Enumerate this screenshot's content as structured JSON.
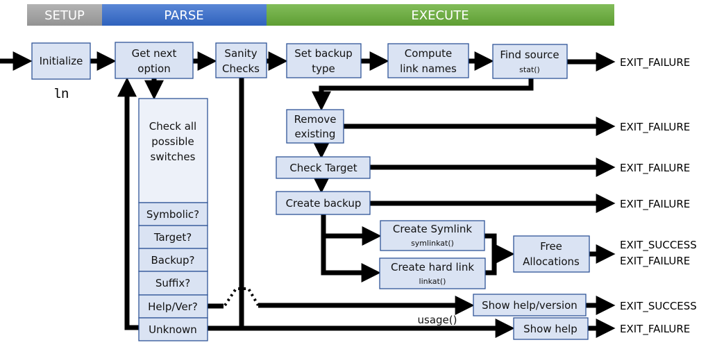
{
  "phases": [
    {
      "label": "SETUP",
      "color": "#a6a6a6"
    },
    {
      "label": "PARSE",
      "color": "#4472c4"
    },
    {
      "label": "EXECUTE",
      "color": "#70ad47"
    }
  ],
  "program_name": "ln",
  "nodes": {
    "initialize": "Initialize",
    "get_next_option": [
      "Get next",
      "option"
    ],
    "sanity_checks": [
      "Sanity",
      "Checks"
    ],
    "set_backup_type": [
      "Set backup",
      "type"
    ],
    "compute_link_names": [
      "Compute",
      "link names"
    ],
    "find_source": {
      "label": "Find source",
      "sub": "stat()"
    },
    "check_switches": [
      "Check all",
      "possible",
      "switches"
    ],
    "switches": [
      "Symbolic?",
      "Target?",
      "Backup?",
      "Suffix?",
      "Help/Ver?",
      "Unknown"
    ],
    "remove_existing": [
      "Remove",
      "existing"
    ],
    "check_target": "Check Target",
    "create_backup": "Create backup",
    "create_symlink": {
      "label": "Create Symlink",
      "sub": "symlinkat()"
    },
    "create_hard_link": {
      "label": "Create hard link",
      "sub": "linkat()"
    },
    "free_allocations": [
      "Free",
      "Allocations"
    ],
    "show_help_version": "Show help/version",
    "show_help": "Show help"
  },
  "edge_labels": {
    "usage": "usage()"
  },
  "exits": {
    "find_source": "EXIT_FAILURE",
    "remove_existing": "EXIT_FAILURE",
    "check_target": "EXIT_FAILURE",
    "create_backup": "EXIT_FAILURE",
    "free_success": "EXIT_SUCCESS",
    "free_failure": "EXIT_FAILURE",
    "help_version": "EXIT_SUCCESS",
    "show_help": "EXIT_FAILURE"
  }
}
